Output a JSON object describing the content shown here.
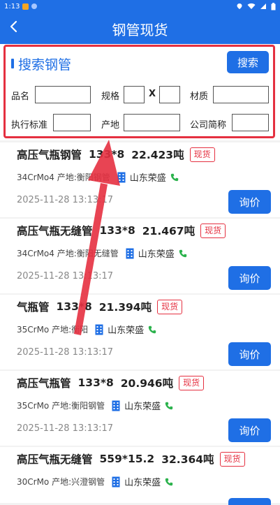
{
  "status": {
    "time": "1:13"
  },
  "header": {
    "title": "钢管现货"
  },
  "search": {
    "title": "搜索钢管",
    "button": "搜索",
    "labels": {
      "name": "品名",
      "spec": "规格",
      "x": "X",
      "material": "材质",
      "standard": "执行标准",
      "origin": "产地",
      "company": "公司简称"
    },
    "values": {
      "name": "",
      "spec1": "",
      "spec2": "",
      "material": "",
      "standard": "",
      "origin": "",
      "company": ""
    }
  },
  "colors": {
    "primary": "#1f6fe5",
    "badge": "#e53040",
    "phone": "#2bb24c"
  },
  "items": [
    {
      "title": "高压气瓶钢管",
      "spec": "133*8",
      "weight": "22.423吨",
      "badge": "现货",
      "material": "34CrMo4",
      "origin": "产地:衡阳钢管",
      "company": "山东荣盛",
      "date": "2025-11-28 13:13:17",
      "button": "询价"
    },
    {
      "title": "高压气瓶无缝管",
      "spec": "133*8",
      "weight": "21.467吨",
      "badge": "现货",
      "material": "34CrMo4",
      "origin": "产地:衡阳无缝管",
      "company": "山东荣盛",
      "date": "2025-11-28 13:13:17",
      "button": "询价"
    },
    {
      "title": "气瓶管",
      "spec": "133*8",
      "weight": "21.394吨",
      "badge": "现货",
      "material": "35CrMo",
      "origin": "产地:衡阳",
      "company": "山东荣盛",
      "date": "2025-11-28 13:13:17",
      "button": "询价"
    },
    {
      "title": "高压气瓶管",
      "spec": "133*8",
      "weight": "20.946吨",
      "badge": "现货",
      "material": "35CrMo",
      "origin": "产地:衡阳钢管",
      "company": "山东荣盛",
      "date": "2025-11-28 13:13:17",
      "button": "询价"
    },
    {
      "title": "高压气瓶无缝管",
      "spec": "559*15.2",
      "weight": "32.364吨",
      "badge": "现货",
      "material": "30CrMo",
      "origin": "产地:兴澄钢管",
      "company": "山东荣盛",
      "date": "",
      "button": ""
    }
  ]
}
